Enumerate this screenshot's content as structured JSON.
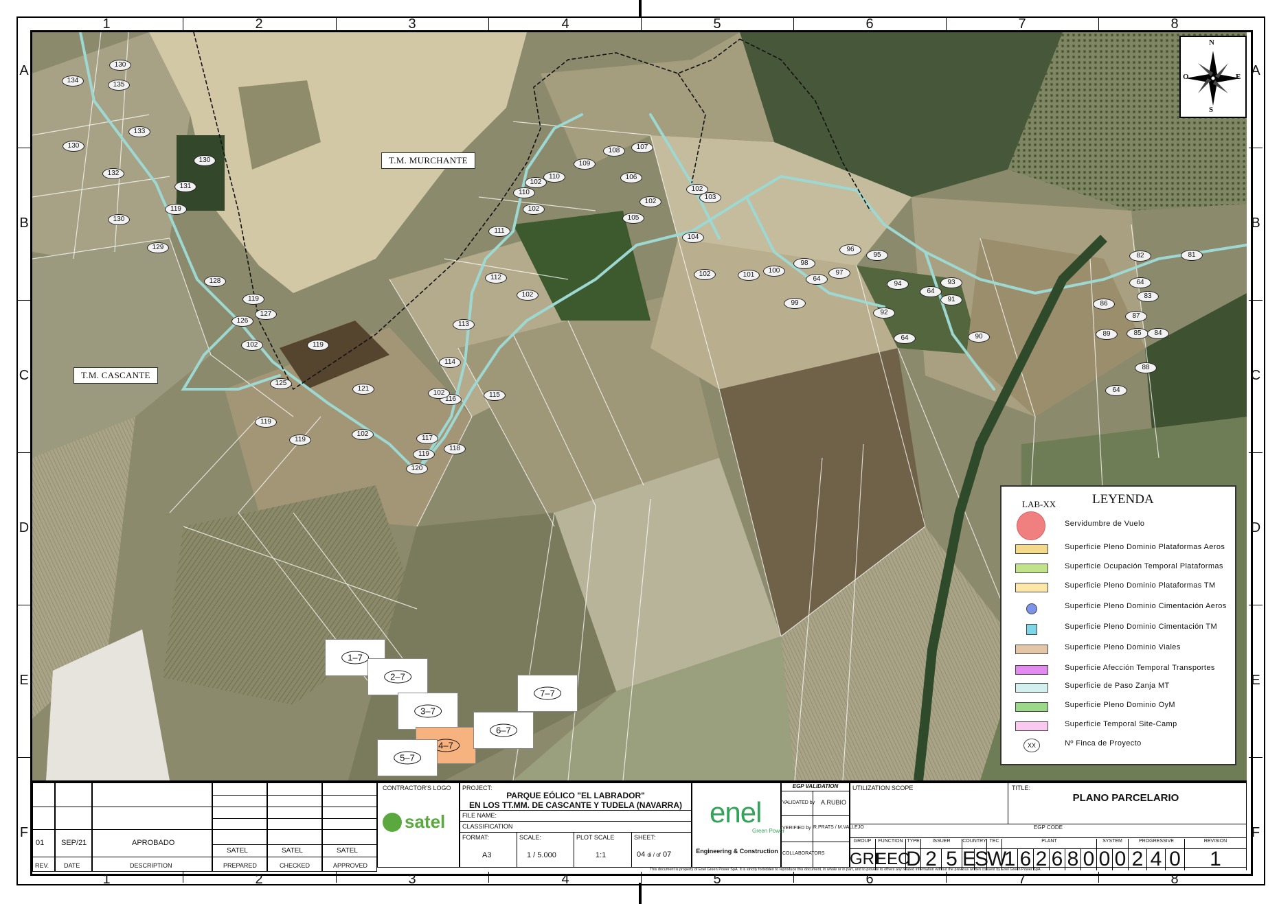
{
  "grid": {
    "columns": [
      "1",
      "2",
      "3",
      "4",
      "5",
      "6",
      "7",
      "8"
    ],
    "rows": [
      "A",
      "B",
      "C",
      "D",
      "E",
      "F"
    ]
  },
  "map": {
    "areas": [
      "T.M. MURCHANTE",
      "T.M. CASCANTE"
    ],
    "parcel_labels": [
      "130",
      "134",
      "135",
      "133",
      "130",
      "132",
      "130",
      "131",
      "119",
      "130",
      "129",
      "128",
      "119",
      "127",
      "126",
      "102",
      "119",
      "125",
      "121",
      "119",
      "119",
      "102",
      "119",
      "120",
      "118",
      "117",
      "116",
      "102",
      "114",
      "115",
      "113",
      "112",
      "102",
      "111",
      "102",
      "110",
      "102",
      "110",
      "109",
      "108",
      "107",
      "106",
      "102",
      "105",
      "102",
      "103",
      "104",
      "102",
      "101",
      "100",
      "99",
      "98",
      "64",
      "97",
      "96",
      "95",
      "94",
      "64",
      "93",
      "92",
      "91",
      "64",
      "90",
      "82",
      "81",
      "64",
      "83",
      "86",
      "87",
      "85",
      "84",
      "89",
      "88",
      "64"
    ],
    "sheets": [
      "1–7",
      "2–7",
      "3–7",
      "4–7",
      "5–7",
      "6–7",
      "7–7"
    ],
    "active_sheet": "4–7"
  },
  "compass": {
    "n": "N",
    "s": "S",
    "e": "E",
    "w": "O"
  },
  "legend": {
    "prefix": "LAB-XX",
    "title": "LEYENDA",
    "items": [
      {
        "label": "Servidumbre de Vuelo",
        "color": "#f08080"
      },
      {
        "label": "Superficie Pleno Dominio Plataformas Aeros",
        "color": "#f4d98a"
      },
      {
        "label": "Superficie Ocupación Temporal Plataformas",
        "color": "#bfe28a"
      },
      {
        "label": "Superficie Pleno Dominio Plataformas TM",
        "color": "#fde7a8"
      },
      {
        "label": "Superficie Pleno Dominio Cimentación Aeros",
        "color": "#7b93e8"
      },
      {
        "label": "Superficie Pleno Dominio Cimentación TM",
        "color": "#7fd6e6"
      },
      {
        "label": "Superficie Pleno Dominio Viales",
        "color": "#e2c6a6"
      },
      {
        "label": "Superficie Afección Temporal Transportes",
        "color": "#e38af0"
      },
      {
        "label": "Superficie de Paso Zanja MT",
        "color": "#d4f0ee"
      },
      {
        "label": "Superficie Pleno Dominio OyM",
        "color": "#9bd88a"
      },
      {
        "label": "Superficie Temporal Site-Camp",
        "color": "#fac9ef"
      },
      {
        "label": "Nº Finca de Proyecto",
        "color": "#ffffff",
        "symbol": "XX"
      }
    ]
  },
  "title_block": {
    "revision": {
      "rev": "01",
      "date": "SEP/21",
      "description": "APROBADO",
      "prepared": "SATEL",
      "checked": "SATEL",
      "approved": "SATEL",
      "h_rev": "REV.",
      "h_date": "DATE",
      "h_desc": "DESCRIPTION",
      "h_prepared": "PREPARED",
      "h_checked": "CHECKED",
      "h_approved": "APPROVED"
    },
    "contractor_logo_label": "CONTRACTOR'S LOGO",
    "contractor": "satel",
    "project_label": "PROJECT:",
    "project_line1": "PARQUE EÓLICO \"EL LABRADOR\"",
    "project_line2": "EN LOS TT.MM. DE CASCANTE Y TUDELA (NAVARRA)",
    "file_name_label": "FILE NAME:",
    "classification_label": "CLASSIFICATION",
    "format_label": "FORMAT:",
    "format": "A3",
    "scale_label": "SCALE:",
    "scale": "1 / 5.000",
    "plot_scale_label": "PLOT SCALE",
    "plot_scale": "1:1",
    "sheet_label": "SHEET:",
    "sheet": "04",
    "sheet_of": "di / of",
    "sheet_total": "07",
    "company": "enel",
    "company_sub": "Green Power",
    "company_division": "Engineering & Construction",
    "egp_validation": "EGP VALIDATION",
    "validated_by_label": "VALIDATED by",
    "validated_by": "A.RUBIO",
    "verified_by_label": "VERIFIED by",
    "verified_by": "R.PRATS / M.VALLEJO",
    "collaborators_label": "COLLABORATORS",
    "utilization_scope_label": "UTILIZATION SCOPE",
    "title_label": "TITLE:",
    "title": "PLANO PARCELARIO",
    "egp_code_label": "EGP CODE",
    "code_headers": [
      "GROUP",
      "FUNCTION",
      "TYPE",
      "ISSUER",
      "COUNTRY",
      "TEC",
      "PLANT",
      "SYSTEM",
      "PROGRESSIVE",
      "REVISION"
    ],
    "code": [
      "GRE",
      "EEC",
      "D",
      "2",
      "5",
      "E",
      "S",
      "W",
      "1",
      "6",
      "2",
      "6",
      "8",
      "0",
      "0",
      "0",
      "2",
      "4",
      "0",
      "1"
    ],
    "disclaimer": "This document is property of Enel Green Power SpA. It is strictly forbidden to reproduce this document, in whole or in part, and to provide to others any related information without the previous written consent by Enel Green Power SpA."
  }
}
